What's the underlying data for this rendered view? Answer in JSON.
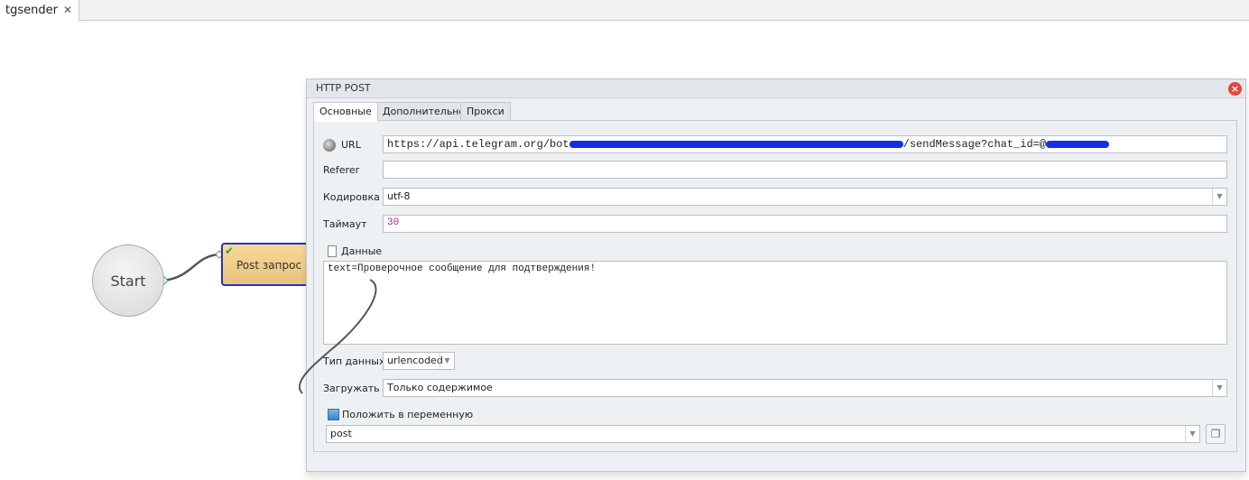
{
  "tabs": [
    {
      "label": "tgsender",
      "close_icon": "close-icon"
    }
  ],
  "canvas": {
    "start_label": "Start",
    "node_label": "Post запрос",
    "node_status": "check-icon"
  },
  "dialog": {
    "title": "HTTP POST",
    "tabs": [
      {
        "label": "Основные",
        "active": true
      },
      {
        "label": "Дополнительно"
      },
      {
        "label": "Прокси"
      }
    ],
    "url": {
      "label": "URL",
      "value_prefix": "https://api.telegram.org/bot",
      "value_middle": "/sendMessage?chat_id=@",
      "redacted": true
    },
    "referer": {
      "label": "Referer",
      "value": ""
    },
    "encoding": {
      "label": "Кодировка",
      "value": "utf-8"
    },
    "timeout": {
      "label": "Таймаут",
      "value": "30"
    },
    "data": {
      "label": "Данные",
      "value": "text=Проверочное сообщение для подтверждения!"
    },
    "data_type": {
      "label": "Тип данных",
      "value": "urlencoded"
    },
    "load": {
      "label": "Загружать",
      "value": "Только содержимое"
    },
    "save_var": {
      "label": "Положить в переменную",
      "value": "post"
    }
  },
  "colors": {
    "node_fill": "#e9c27a",
    "node_border": "#2233cc",
    "redaction": "#1330e8",
    "close": "#e2463a",
    "timeout_text": "#9b2d9b"
  }
}
